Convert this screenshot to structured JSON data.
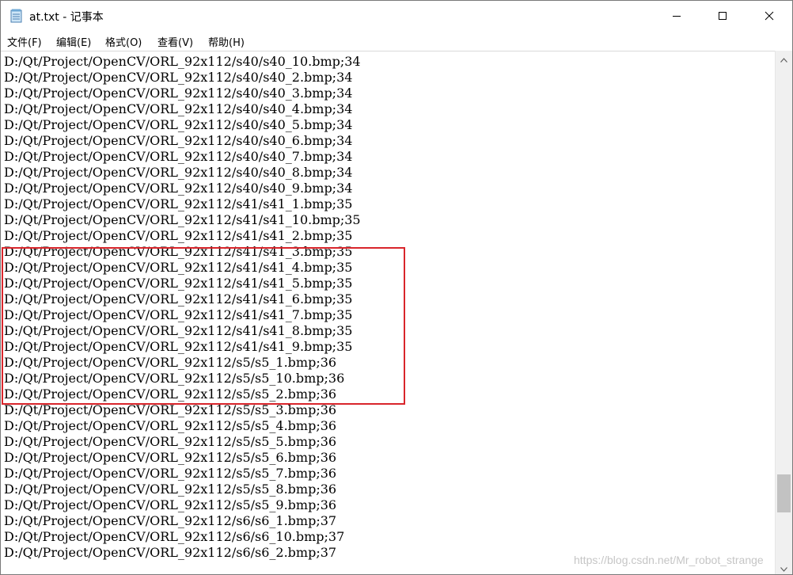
{
  "window": {
    "title": "at.txt - 记事本",
    "app_icon": "notepad-icon"
  },
  "controls": {
    "minimize_icon": "minimize-icon",
    "maximize_icon": "maximize-icon",
    "close_icon": "close-icon"
  },
  "menu": [
    {
      "label": "文件(F)"
    },
    {
      "label": "编辑(E)"
    },
    {
      "label": "格式(O)"
    },
    {
      "label": "查看(V)"
    },
    {
      "label": "帮助(H)"
    }
  ],
  "lines": [
    "D:/Qt/Project/OpenCV/ORL_92x112/s40/s40_10.bmp;34",
    "D:/Qt/Project/OpenCV/ORL_92x112/s40/s40_2.bmp;34",
    "D:/Qt/Project/OpenCV/ORL_92x112/s40/s40_3.bmp;34",
    "D:/Qt/Project/OpenCV/ORL_92x112/s40/s40_4.bmp;34",
    "D:/Qt/Project/OpenCV/ORL_92x112/s40/s40_5.bmp;34",
    "D:/Qt/Project/OpenCV/ORL_92x112/s40/s40_6.bmp;34",
    "D:/Qt/Project/OpenCV/ORL_92x112/s40/s40_7.bmp;34",
    "D:/Qt/Project/OpenCV/ORL_92x112/s40/s40_8.bmp;34",
    "D:/Qt/Project/OpenCV/ORL_92x112/s40/s40_9.bmp;34",
    "D:/Qt/Project/OpenCV/ORL_92x112/s41/s41_1.bmp;35",
    "D:/Qt/Project/OpenCV/ORL_92x112/s41/s41_10.bmp;35",
    "D:/Qt/Project/OpenCV/ORL_92x112/s41/s41_2.bmp;35",
    "D:/Qt/Project/OpenCV/ORL_92x112/s41/s41_3.bmp;35",
    "D:/Qt/Project/OpenCV/ORL_92x112/s41/s41_4.bmp;35",
    "D:/Qt/Project/OpenCV/ORL_92x112/s41/s41_5.bmp;35",
    "D:/Qt/Project/OpenCV/ORL_92x112/s41/s41_6.bmp;35",
    "D:/Qt/Project/OpenCV/ORL_92x112/s41/s41_7.bmp;35",
    "D:/Qt/Project/OpenCV/ORL_92x112/s41/s41_8.bmp;35",
    "D:/Qt/Project/OpenCV/ORL_92x112/s41/s41_9.bmp;35",
    "D:/Qt/Project/OpenCV/ORL_92x112/s5/s5_1.bmp;36",
    "D:/Qt/Project/OpenCV/ORL_92x112/s5/s5_10.bmp;36",
    "D:/Qt/Project/OpenCV/ORL_92x112/s5/s5_2.bmp;36",
    "D:/Qt/Project/OpenCV/ORL_92x112/s5/s5_3.bmp;36",
    "D:/Qt/Project/OpenCV/ORL_92x112/s5/s5_4.bmp;36",
    "D:/Qt/Project/OpenCV/ORL_92x112/s5/s5_5.bmp;36",
    "D:/Qt/Project/OpenCV/ORL_92x112/s5/s5_6.bmp;36",
    "D:/Qt/Project/OpenCV/ORL_92x112/s5/s5_7.bmp;36",
    "D:/Qt/Project/OpenCV/ORL_92x112/s5/s5_8.bmp;36",
    "D:/Qt/Project/OpenCV/ORL_92x112/s5/s5_9.bmp;36",
    "D:/Qt/Project/OpenCV/ORL_92x112/s6/s6_1.bmp;37",
    "D:/Qt/Project/OpenCV/ORL_92x112/s6/s6_10.bmp;37",
    "D:/Qt/Project/OpenCV/ORL_92x112/s6/s6_2.bmp;37"
  ],
  "annotation": {
    "color": "#d9252b"
  },
  "watermark": "https://blog.csdn.net/Mr_robot_strange",
  "scrollbar": {
    "up_icon": "scroll-up-arrow-icon",
    "down_icon": "scroll-down-arrow-icon"
  }
}
